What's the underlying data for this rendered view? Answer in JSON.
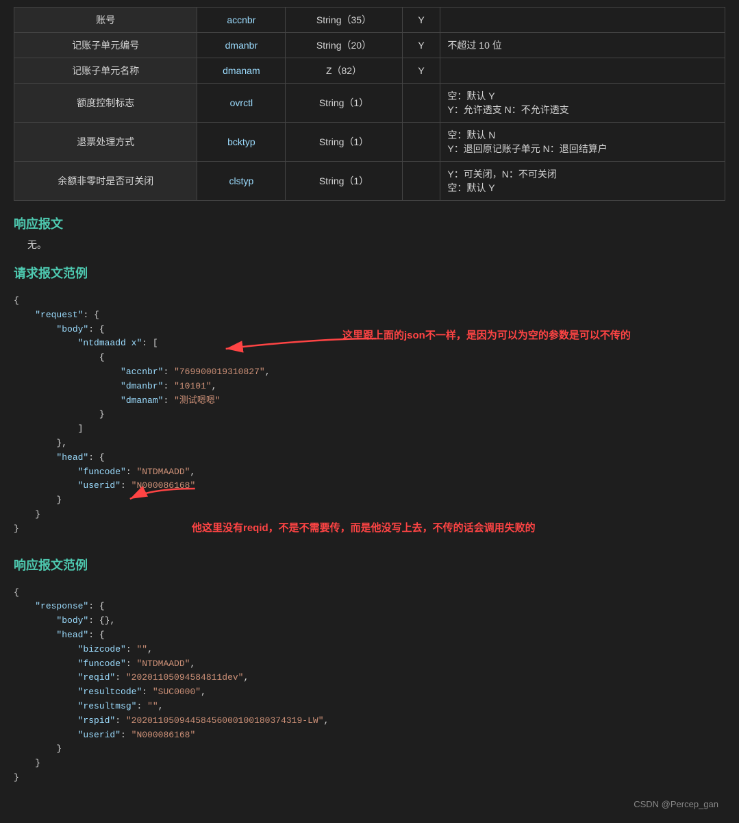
{
  "table": {
    "rows": [
      {
        "col1": "账号",
        "col2": "accnbr",
        "col3": "String (35)",
        "col4": "Y",
        "col5": ""
      },
      {
        "col1": "记账子单元编号",
        "col2": "dmanbr",
        "col3": "String (20)",
        "col4": "Y",
        "col5": "不超过 10 位"
      },
      {
        "col1": "记账子单元名称",
        "col2": "dmanam",
        "col3": "Z（82）",
        "col4": "Y",
        "col5": ""
      },
      {
        "col1": "额度控制标志",
        "col2": "ovrctl",
        "col3": "String（1）",
        "col4": "",
        "col5": "空：默认 Y\nY：允许透支 N：不允许透支"
      },
      {
        "col1": "退票处理方式",
        "col2": "bcktyp",
        "col3": "String（1）",
        "col4": "",
        "col5": "空：默认 N\nY：退回原记账子单元 N：退回结算户"
      },
      {
        "col1": "余额非零时是否可关闭",
        "col2": "clstyp",
        "col3": "String（1）",
        "col4": "",
        "col5": "Y：可关闭，N：不可关闭\n空：默认 Y"
      }
    ]
  },
  "sections": {
    "response_heading": "响应报文",
    "response_none": "无。",
    "request_example_heading": "请求报文范例",
    "response_example_heading": "响应报文范例"
  },
  "request_code": {
    "line1": "{",
    "annotation1": "这里跟上面的json不一样，是因为可以为空的参数是可以不传的",
    "annotation2": "他这里没有reqid，不是不需要传，而是他没写上去，不传的话会调用失败的",
    "content": "    \"request\": {\n        \"body\": {\n            \"ntdmaadd x\": [\n                {\n                    \"accnbr\": \"769900019310827\",\n                    \"dmanbr\": \"10101\",\n                    \"dmanam\": \"测试嗯嗯\"\n                }\n            ]\n        },\n        \"head\": {\n            \"funcode\": \"NTDMAADD\",\n            \"userid\": \"N000086168\"\n        }\n    }\n}"
  },
  "response_code": {
    "content": "{\n    \"response\": {\n        \"body\": {},\n        \"head\": {\n            \"bizcode\": \"\",\n            \"funcode\": \"NTDMAADD\",\n            \"reqid\": \"20201105094584811dev\",\n            \"resultcode\": \"SUC0000\",\n            \"resultmsg\": \"\",\n            \"rspid\": \"202011050944584560001001 80374319-LW\",\n            \"userid\": \"N000086168\"\n        }\n    }\n}"
  },
  "footer": {
    "text": "CSDN @Percep_gan"
  }
}
